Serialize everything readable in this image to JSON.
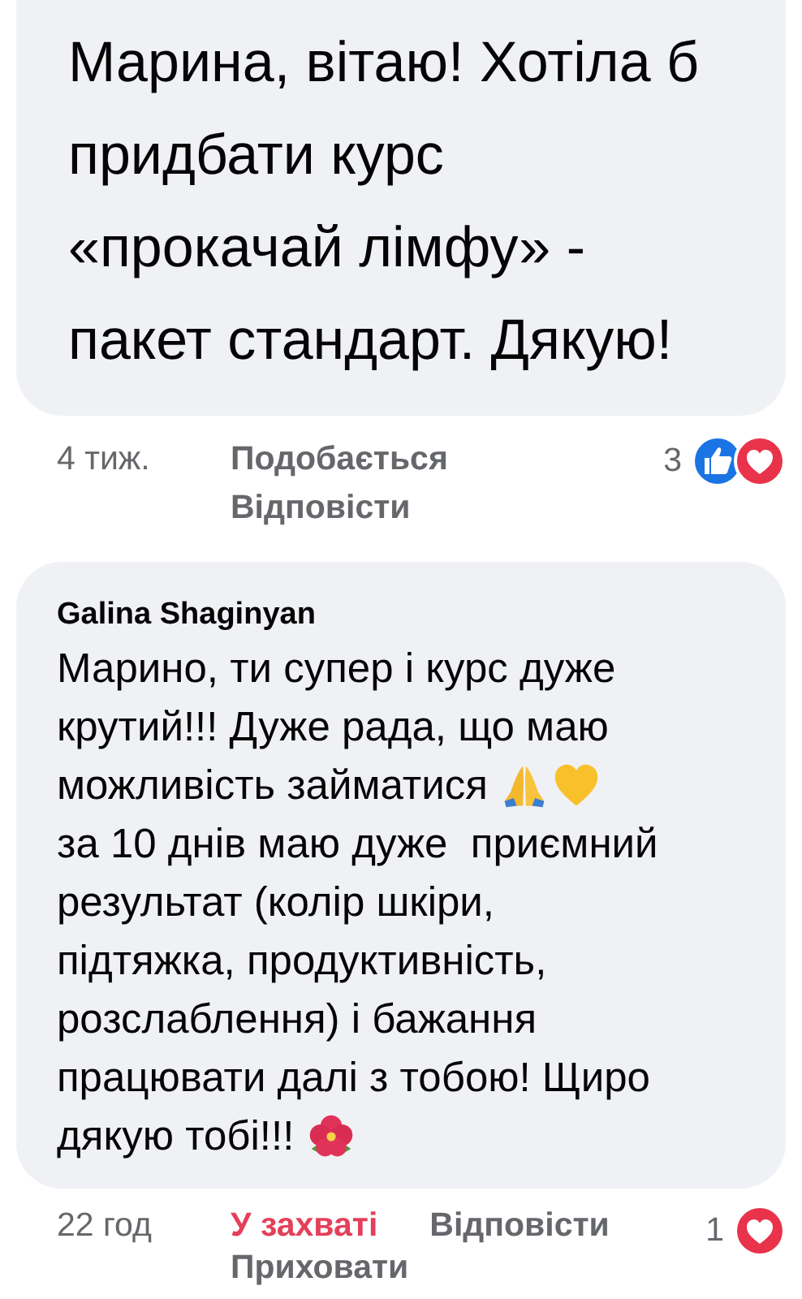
{
  "comments": [
    {
      "lines": [
        [
          {
            "kind": "text",
            "text": "Марина, вітаю! Хотіла б"
          }
        ],
        [
          {
            "kind": "text",
            "text": "придбати курс"
          }
        ],
        [
          {
            "kind": "text",
            "text": "«прокачай лімфу» -"
          }
        ],
        [
          {
            "kind": "text",
            "text": "пакет стандарт. Дякую!"
          }
        ]
      ],
      "time": "4 тиж.",
      "actions": [
        {
          "label": "Подобається",
          "selected": false
        },
        {
          "label": "Відповісти",
          "selected": false
        }
      ],
      "reaction_count": "3",
      "reactions": [
        {
          "kind": "like"
        },
        {
          "kind": "love"
        }
      ]
    },
    {
      "author": "Galina Shaginyan",
      "lines": [
        [
          {
            "kind": "text",
            "text": "Марино, ти супер і курс дуже"
          }
        ],
        [
          {
            "kind": "text",
            "text": "крутий!!! Дуже рада, що маю"
          }
        ],
        [
          {
            "kind": "text",
            "text": "можливість займатися"
          },
          {
            "kind": "pray"
          },
          {
            "kind": "heart"
          }
        ],
        [
          {
            "kind": "text",
            "text": "за 10 днів маю дуже  приємний"
          }
        ],
        [
          {
            "kind": "text",
            "text": "результат (колір шкіри,"
          }
        ],
        [
          {
            "kind": "text",
            "text": "підтяжка, продуктивність,"
          }
        ],
        [
          {
            "kind": "text",
            "text": "розслаблення) і бажання"
          }
        ],
        [
          {
            "kind": "text",
            "text": "працювати далі з тобою! Щиро"
          }
        ],
        [
          {
            "kind": "text",
            "text": "дякую тобі!!!"
          },
          {
            "kind": "flower"
          }
        ]
      ],
      "time": "22 год",
      "actions": [
        {
          "label": "У захваті",
          "selected": true
        },
        {
          "label": "Відповісти",
          "selected": false
        },
        {
          "label": "Приховати",
          "selected": false
        }
      ],
      "reaction_count": "1",
      "reactions": [
        {
          "kind": "love"
        }
      ]
    }
  ]
}
